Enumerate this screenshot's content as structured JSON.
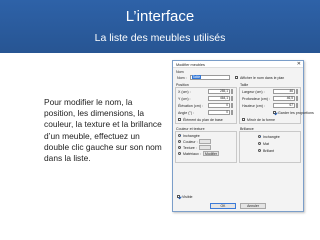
{
  "header": {
    "title": "L’interface",
    "subtitle": "La liste des meubles utilisés"
  },
  "body_text": "Pour modifier le nom, la position, les dimensions, la couleur, la texture et la brillance d’un meuble, effectuez un double clic gauche sur son nom dans la liste.",
  "dialog": {
    "title": "Modifier meubles",
    "close": "✕",
    "name_label": "Nom",
    "name_field_label": "Nom :",
    "name_value": "Table",
    "show_in_plan_label": "Afficher le nom dans le plan",
    "position_label": "Position",
    "x_label": "X (cm) :",
    "x_value": "285,1",
    "y_label": "Y (cm) :",
    "y_value": "464,1",
    "elevation_label": "Élévation (cm) :",
    "elevation_value": "0",
    "angle_label": "Angle (°) :",
    "angle_value": "0",
    "base_plan_label": "Élément du plan de base",
    "size_label": "Taille",
    "width_label": "Largeur (cm) :",
    "width_value": "46",
    "depth_label": "Profondeur (cm) :",
    "depth_value": "46,5",
    "height_label": "Hauteur (cm) :",
    "height_value": "67",
    "keep_proportions_label": "Garder les proportions",
    "mirror_label": "Miroir de la forme",
    "color_texture_label": "Couleur et texture",
    "unchanged_label": "Inchangée",
    "color_label": "Couleur :",
    "texture_label": "Texture :",
    "materials_label": "Matériaux :",
    "modify_label": "Modifier",
    "shininess_label": "Brillance",
    "shine_unchanged_label": "Inchangée",
    "matte_label": "Mat",
    "shiny_label": "Brillant",
    "visible_label": "Visible",
    "ok_label": "OK",
    "cancel_label": "Annuler"
  }
}
